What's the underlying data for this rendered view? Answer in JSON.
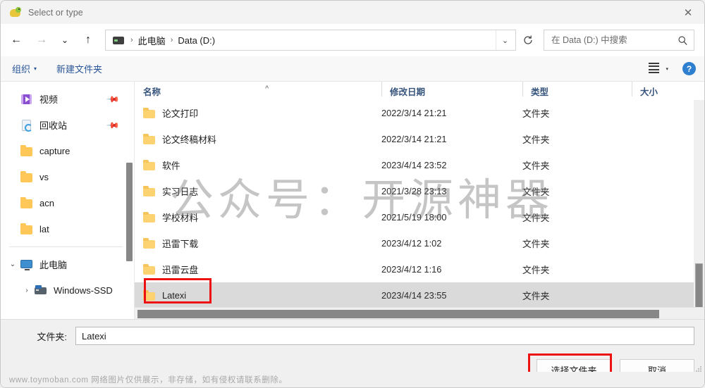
{
  "window": {
    "title": "Select or type",
    "app_icon": "duck-icon",
    "close_label": "✕"
  },
  "nav": {
    "back": "←",
    "forward": "→",
    "recent": "⌄",
    "up": "↑",
    "refresh": "refresh-icon",
    "chevron": "⌄"
  },
  "breadcrumb": {
    "drive_icon": "drive-icon",
    "sep1": "›",
    "item1": "此电脑",
    "sep2": "›",
    "item2": "Data (D:)"
  },
  "search": {
    "placeholder": "在 Data (D:) 中搜索",
    "icon": "search-icon"
  },
  "toolbar": {
    "organize": "组织",
    "organize_caret": "▾",
    "new_folder": "新建文件夹",
    "view_icon": "list-view-icon",
    "view_caret": "▾",
    "help": "?"
  },
  "sidebar": {
    "items": [
      {
        "label": "视频",
        "icon": "video-icon",
        "pinned": true,
        "indent": 1
      },
      {
        "label": "回收站",
        "icon": "recycle-bin-icon",
        "pinned": true,
        "indent": 1
      },
      {
        "label": "capture",
        "icon": "folder-icon",
        "pinned": false,
        "indent": 1
      },
      {
        "label": "vs",
        "icon": "folder-icon",
        "pinned": false,
        "indent": 1
      },
      {
        "label": "acn",
        "icon": "folder-icon",
        "pinned": false,
        "indent": 1
      },
      {
        "label": "lat",
        "icon": "folder-icon",
        "pinned": false,
        "indent": 1
      }
    ],
    "computer": {
      "twisty": "⌄",
      "label": "此电脑",
      "icon": "this-pc-icon"
    },
    "drive": {
      "twisty": "›",
      "label": "Windows-SSD",
      "icon": "hard-drive-icon"
    }
  },
  "filelist": {
    "columns": [
      "名称",
      "修改日期",
      "类型",
      "大小"
    ],
    "sort_indicator": "^",
    "rows": [
      {
        "name": "论文打印",
        "date": "2022/3/14 21:21",
        "type": "文件夹",
        "size": "",
        "selected": false
      },
      {
        "name": "论文终稿材料",
        "date": "2022/3/14 21:21",
        "type": "文件夹",
        "size": "",
        "selected": false
      },
      {
        "name": "软件",
        "date": "2023/4/14 23:52",
        "type": "文件夹",
        "size": "",
        "selected": false
      },
      {
        "name": "实习日志",
        "date": "2021/3/28 23:13",
        "type": "文件夹",
        "size": "",
        "selected": false
      },
      {
        "name": "学校材料",
        "date": "2021/5/19 18:00",
        "type": "文件夹",
        "size": "",
        "selected": false
      },
      {
        "name": "迅雷下载",
        "date": "2023/4/12 1:02",
        "type": "文件夹",
        "size": "",
        "selected": false
      },
      {
        "name": "迅雷云盘",
        "date": "2023/4/12 1:16",
        "type": "文件夹",
        "size": "",
        "selected": false
      },
      {
        "name": "Latexi",
        "date": "2023/4/14 23:55",
        "type": "文件夹",
        "size": "",
        "selected": true
      }
    ]
  },
  "footer": {
    "folder_label": "文件夹:",
    "folder_value": "Latexi",
    "select_button": "选择文件夹",
    "cancel_button": "取消"
  },
  "watermarks": {
    "center": "公众号：开源神器",
    "bottom": "www.toymoban.com 网络图片仅供展示，非存储，如有侵权请联系删除。"
  },
  "colors": {
    "accent_link": "#2a5699",
    "highlight_box": "#ee1111",
    "selection": "#dadada",
    "folder": "#fdd270"
  }
}
